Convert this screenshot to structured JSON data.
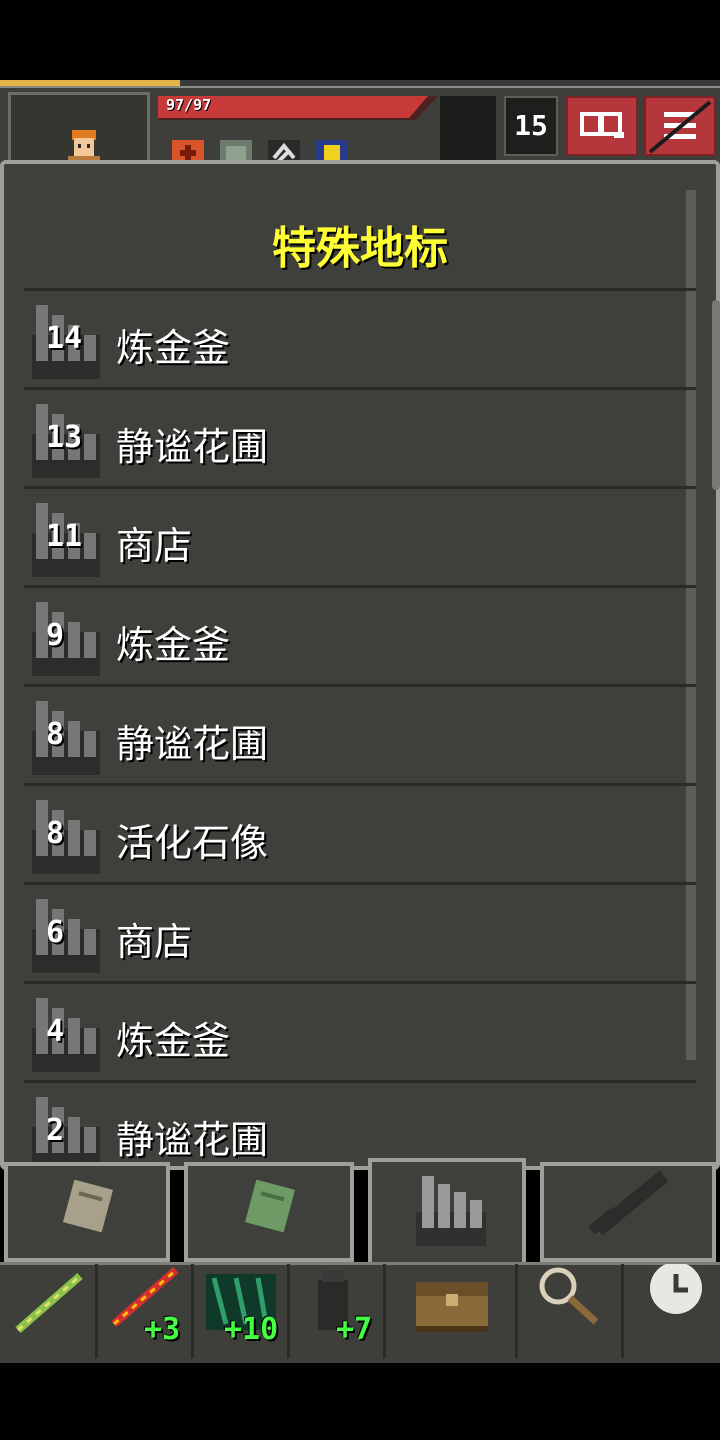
{
  "hud": {
    "hp_text": "97/97",
    "hp_fraction": 1.0,
    "depth": "15",
    "xp_fraction": 0.25
  },
  "panel": {
    "title": "特殊地标",
    "entries": [
      {
        "depth": "14",
        "name": "炼金釜"
      },
      {
        "depth": "13",
        "name": "静谧花圃"
      },
      {
        "depth": "11",
        "name": "商店"
      },
      {
        "depth": "9",
        "name": "炼金釜"
      },
      {
        "depth": "8",
        "name": "静谧花圃"
      },
      {
        "depth": "8",
        "name": "活化石像"
      },
      {
        "depth": "6",
        "name": "商店"
      },
      {
        "depth": "4",
        "name": "炼金釜"
      },
      {
        "depth": "2",
        "name": "静谧花圃"
      }
    ]
  },
  "toolbar": {
    "slot2_bonus": "+3",
    "slot3_bonus": "+10",
    "slot4_bonus": "+7"
  },
  "icons": {
    "journal": "journal-icon",
    "menu": "menu-icon",
    "search": "magnifier-icon",
    "wait": "clock-icon",
    "backpack": "chest-icon"
  },
  "colors": {
    "title": "#ffff33",
    "bonus": "#44ff44",
    "hp": "#c83a3a"
  }
}
